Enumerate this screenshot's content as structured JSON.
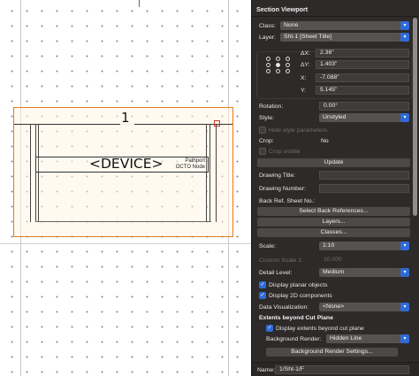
{
  "drawing": {
    "viewport_number": "1",
    "device_label": "<DEVICE>",
    "device_sub_1": "Pathport",
    "device_sub_2": "OCTO Node"
  },
  "palette": {
    "title": "Section Viewport",
    "class": {
      "label": "Class:",
      "value": "None"
    },
    "layer": {
      "label": "Layer:",
      "value": "Sht-1 [Sheet Title]"
    },
    "dx": {
      "label": "ΔX:",
      "value": "2.36\""
    },
    "dy": {
      "label": "ΔY:",
      "value": "1.403\""
    },
    "x": {
      "label": "X:",
      "value": "-7.088\""
    },
    "y": {
      "label": "Y:",
      "value": "5.145\""
    },
    "rotation": {
      "label": "Rotation:",
      "value": "0.00°"
    },
    "style": {
      "label": "Style:",
      "value": "Unstyled"
    },
    "hide_style_params": "Hide style parameters",
    "crop": {
      "label": "Crop:",
      "value": "No"
    },
    "crop_visible": "Crop visible",
    "update_button": "Update",
    "drawing_title": {
      "label": "Drawing Title:",
      "value": ""
    },
    "drawing_number": {
      "label": "Drawing Number:",
      "value": ""
    },
    "back_ref": {
      "label": "Back Ref. Sheet No.:"
    },
    "select_back_refs_button": "Select Back References...",
    "layers_button": "Layers...",
    "classes_button": "Classes...",
    "scale": {
      "label": "Scale:",
      "value": "1:10"
    },
    "custom_scale": {
      "label": "Custom Scale 1:",
      "value": "10.000"
    },
    "detail_level": {
      "label": "Detail Level:",
      "value": "Medium"
    },
    "display_planar": "Display planar objects",
    "display_2d": "Display 2D components",
    "data_viz": {
      "label": "Data Visualization:",
      "value": "<None>"
    },
    "extents_header": "Extents beyond Cut Plane",
    "display_extents": "Display extents beyond cut plane",
    "background_render": {
      "label": "Background Render:",
      "value": "Hidden Line"
    },
    "bg_render_settings_button": "Background Render Settings...",
    "name": {
      "label": "Name:",
      "value": "1/Sht-1/F"
    }
  },
  "colors": {
    "palette_bg": "#2d2a29",
    "accent": "#2f6bd8",
    "viewport_border": "#e07b1c",
    "handle": "#d0332b"
  }
}
